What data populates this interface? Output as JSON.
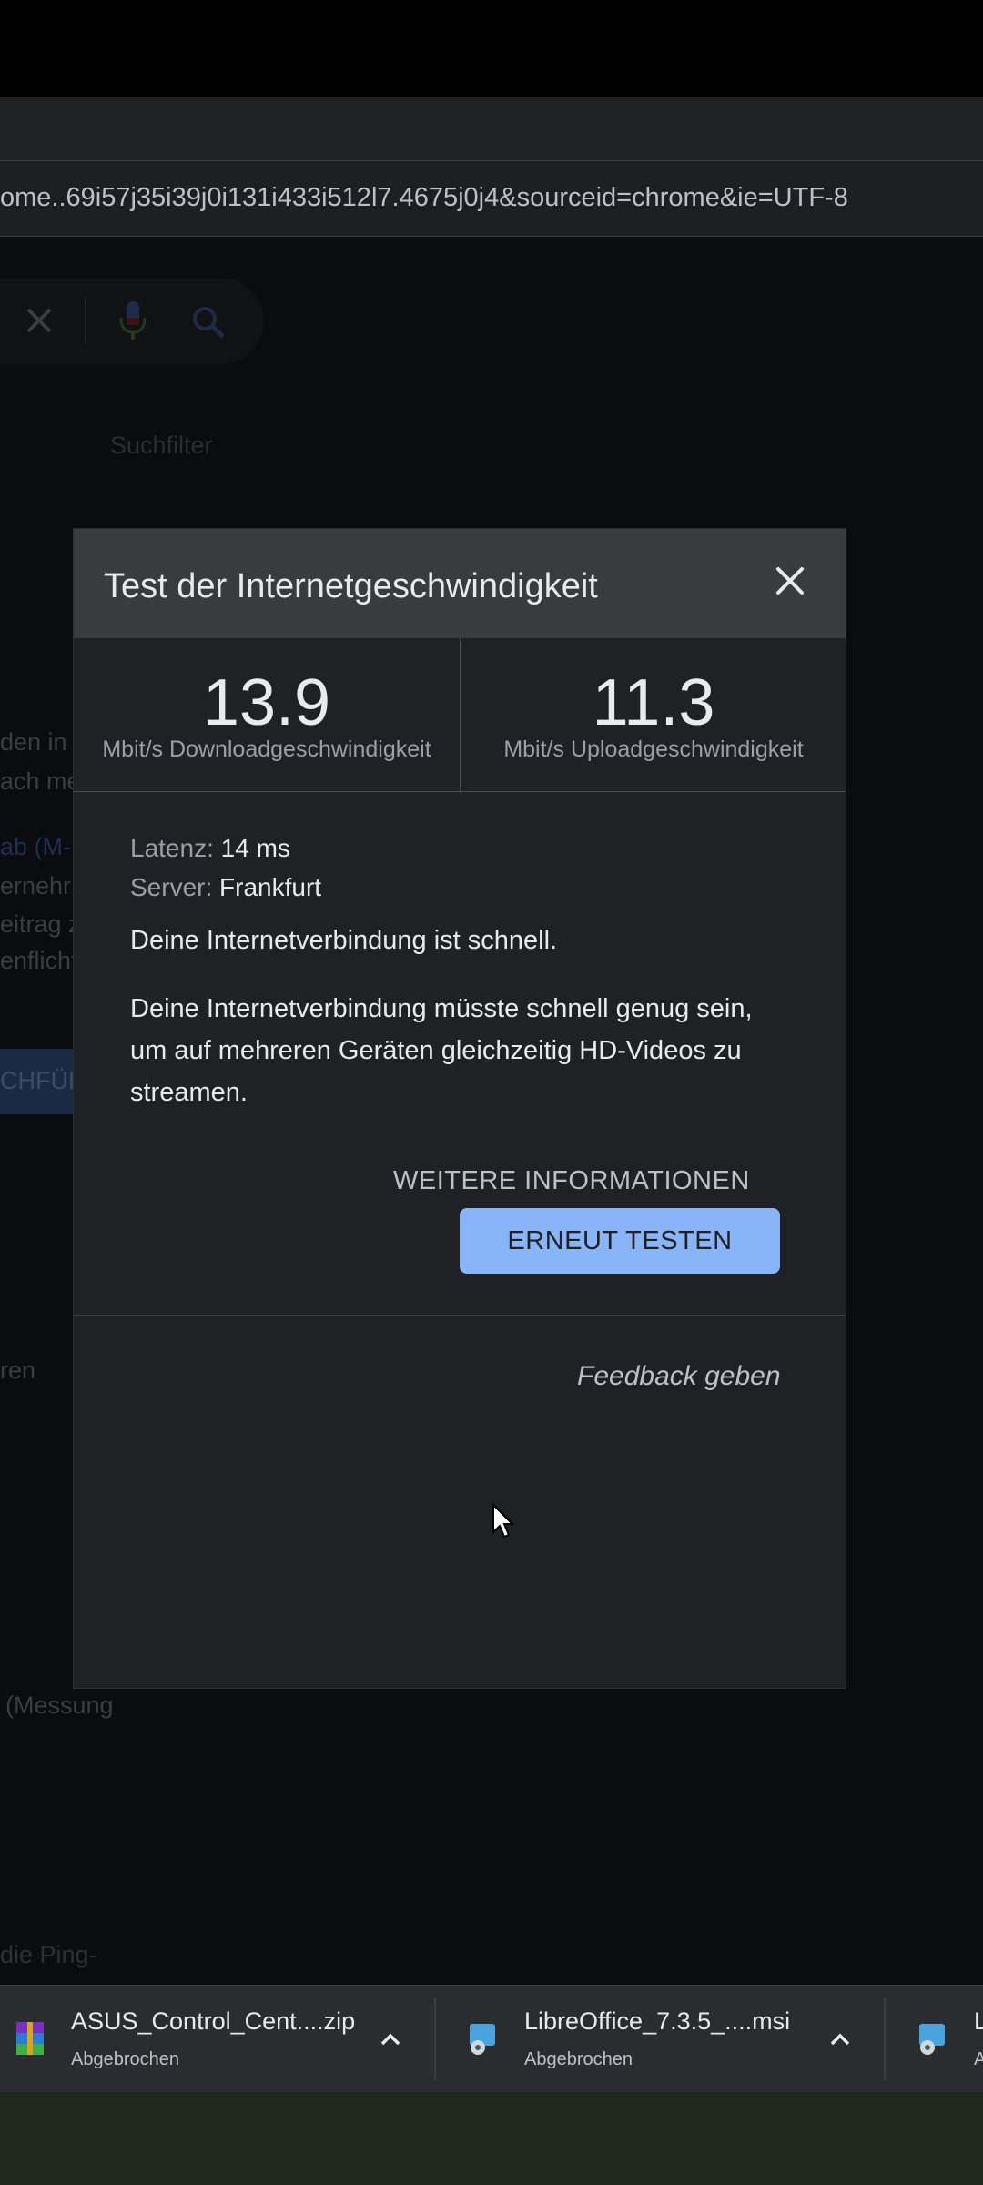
{
  "browser": {
    "url": "ome..69i57j35i39j0i131i433i512l7.4675j0j4&sourceid=chrome&ie=UTF-8"
  },
  "background_page": {
    "search_filter_label": "Suchfilter",
    "fragments": [
      "den in",
      "ach me",
      "ab (M-",
      "ernehr",
      "eitrag z",
      "enflicht",
      "CHFÜH",
      "ren",
      "(Messung",
      "die Ping-"
    ]
  },
  "dialog": {
    "title": "Test der Internetgeschwindigkeit",
    "download": {
      "value": "13.9",
      "label": "Mbit/s Downloadgeschwindigkeit"
    },
    "upload": {
      "value": "11.3",
      "label": "Mbit/s Uploadgeschwindigkeit"
    },
    "latency_label": "Latenz:",
    "latency_value": "14 ms",
    "server_label": "Server:",
    "server_value": "Frankfurt",
    "status_text": "Deine Internetverbindung ist schnell.",
    "description": "Deine Internetverbindung müsste schnell genug sein, um auf mehreren Geräten gleichzeitig HD-Videos zu streamen.",
    "more_info": "WEITERE INFORMATIONEN",
    "retest": "ERNEUT TESTEN",
    "feedback": "Feedback geben"
  },
  "downloads": [
    {
      "name": "ASUS_Control_Cent....zip",
      "status": "Abgebrochen",
      "icon": "winrar-archive-icon"
    },
    {
      "name": "LibreOffice_7.3.5_....msi",
      "status": "Abgebrochen",
      "icon": "msi-installer-icon"
    },
    {
      "name": "L",
      "status": "A",
      "icon": "msi-installer-icon"
    }
  ],
  "colors": {
    "accent_button": "#8ab4f8",
    "dialog_bg": "#202124",
    "dialog_header": "#3a3b3e"
  }
}
